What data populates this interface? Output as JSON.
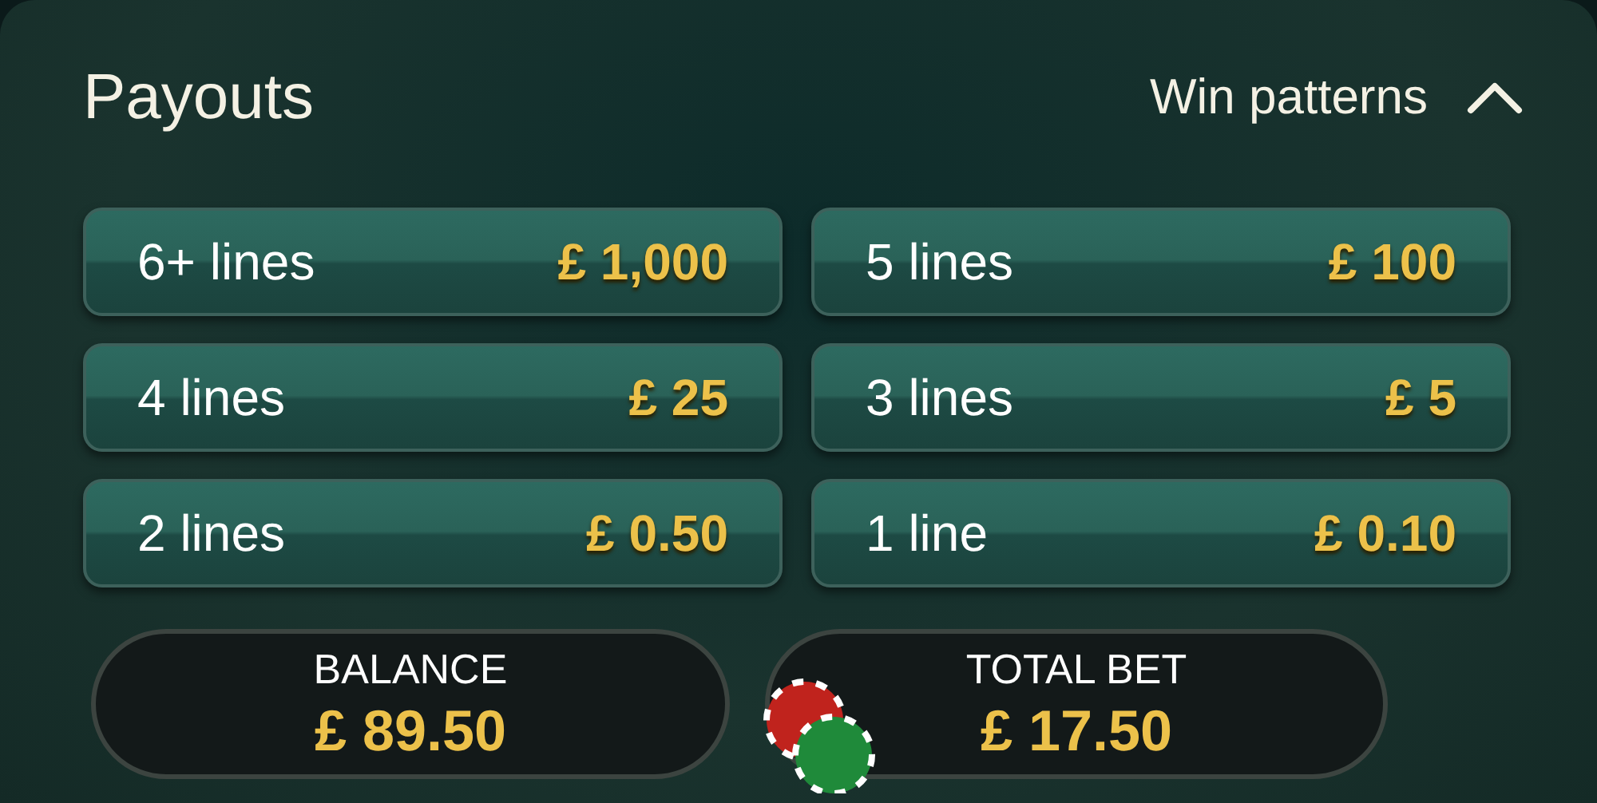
{
  "header": {
    "title": "Payouts",
    "toggle": {
      "label": "Win patterns",
      "expanded": true
    }
  },
  "payouts": [
    {
      "label": "6+ lines",
      "amount": "£ 1,000"
    },
    {
      "label": "5 lines",
      "amount": "£ 100"
    },
    {
      "label": "4 lines",
      "amount": "£ 25"
    },
    {
      "label": "3 lines",
      "amount": "£ 5"
    },
    {
      "label": "2 lines",
      "amount": "£ 0.50"
    },
    {
      "label": "1 line",
      "amount": "£ 0.10"
    }
  ],
  "footer": [
    {
      "kind": "balance",
      "label": "BALANCE",
      "value": "£ 89.50"
    },
    {
      "kind": "bet",
      "label": "TOTAL BET",
      "value": "£ 17.50"
    }
  ]
}
